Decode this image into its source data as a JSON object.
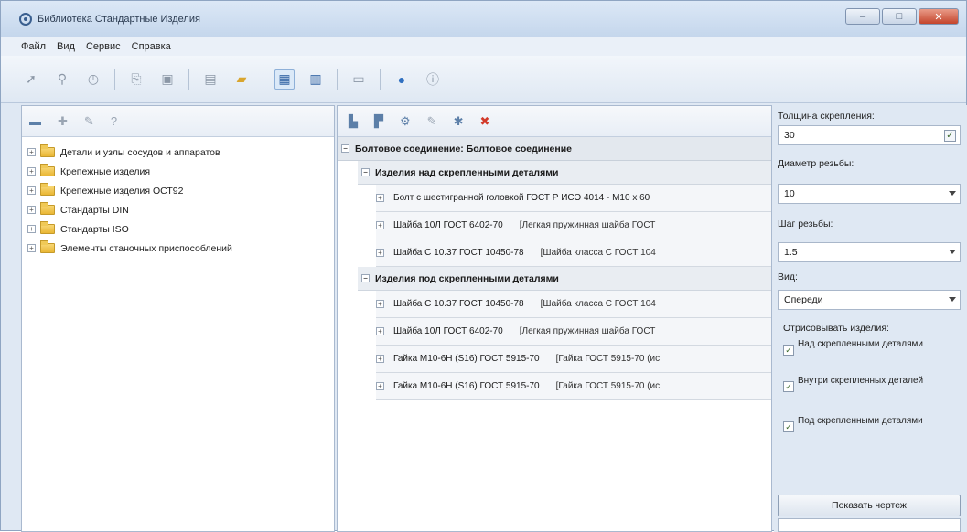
{
  "window": {
    "title": "Библиотека Стандартные Изделия",
    "controls": {
      "minimize": "–",
      "maximize": "□",
      "close": "✕"
    }
  },
  "menu": [
    "Файл",
    "Вид",
    "Сервис",
    "Справка"
  ],
  "toolbar_icons": [
    "cursor-icon",
    "binoculars-icon",
    "history-icon",
    "copy-icon",
    "paste-icon",
    "document-icon",
    "folder-open-icon",
    "panel-view-icon",
    "grid-view-icon",
    "window-icon",
    "help-icon",
    "info-icon"
  ],
  "tree": [
    {
      "label": "Детали и узлы сосудов и аппаратов"
    },
    {
      "label": "Крепежные изделия"
    },
    {
      "label": "Крепежные изделия ОСТ92"
    },
    {
      "label": "Стандарты DIN"
    },
    {
      "label": "Стандарты ISO"
    },
    {
      "label": "Элементы станочных приспособлений"
    }
  ],
  "connection": {
    "title": "Болтовое соединение: Болтовое соединение",
    "groups": [
      {
        "title": "Изделия над скрепленными деталями",
        "rows": [
          {
            "name": "Болт с шестигранной головкой ГОСТ Р ИСО 4014 - М10 х 60",
            "desc": ""
          },
          {
            "name": "Шайба 10Л ГОСТ 6402-70",
            "desc": "[Легкая пружинная шайба ГОСТ"
          },
          {
            "name": "Шайба С 10.37 ГОСТ 10450-78",
            "desc": "[Шайба класса С ГОСТ 104"
          }
        ]
      },
      {
        "title": "Изделия под скрепленными деталями",
        "rows": [
          {
            "name": "Шайба С 10.37 ГОСТ 10450-78",
            "desc": "[Шайба класса С ГОСТ 104"
          },
          {
            "name": "Шайба 10Л ГОСТ 6402-70",
            "desc": "[Легкая пружинная шайба ГОСТ"
          },
          {
            "name": "Гайка М10-6Н (S16) ГОСТ 5915-70",
            "desc": "[Гайка ГОСТ 5915-70 (ис"
          },
          {
            "name": "Гайка М10-6Н (S16) ГОСТ 5915-70",
            "desc": "[Гайка ГОСТ 5915-70 (ис"
          }
        ]
      }
    ]
  },
  "params": {
    "thickness_label": "Толщина скрепления:",
    "thickness_value": "30",
    "diameter_label": "Диаметр резьбы:",
    "diameter_value": "10",
    "pitch_label": "Шаг резьбы:",
    "pitch_value": "1.5",
    "view_label": "Вид:",
    "view_value": "Спереди",
    "draw_label": "Отрисовывать изделия:",
    "checks": [
      {
        "label": "Над скрепленными деталями",
        "checked": true
      },
      {
        "label": "Внутри скрепленных деталей",
        "checked": true
      },
      {
        "label": "Под скрепленными деталями",
        "checked": true
      }
    ],
    "show_button": "Показать чертеж"
  }
}
